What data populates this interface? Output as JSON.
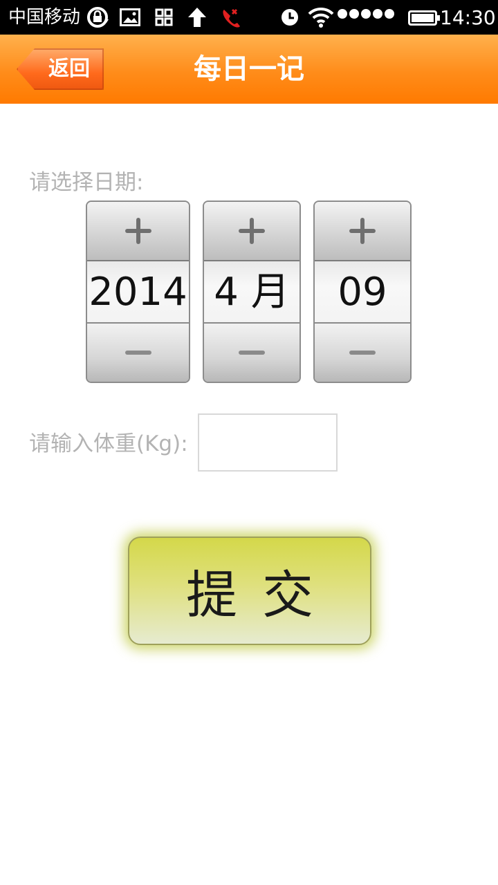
{
  "status_bar": {
    "carrier": "中国移动",
    "time": "14:30",
    "icons": [
      "rotation-lock-icon",
      "image-icon",
      "apps-icon",
      "upload-arrow-icon",
      "missed-call-icon",
      "alarm-clock-icon",
      "wifi-icon",
      "signal-dots-icon",
      "battery-charging-icon"
    ],
    "missed_call_color": "#e02020"
  },
  "header": {
    "back_label": "返回",
    "title": "每日一记",
    "accent": "#ff8c1a"
  },
  "form": {
    "date_label": "请选择日期:",
    "date": {
      "year": "2014",
      "month": "4 月",
      "day": "09"
    },
    "weight_label": "请输入体重(Kg):",
    "weight_value": "",
    "submit_label": "提交"
  }
}
